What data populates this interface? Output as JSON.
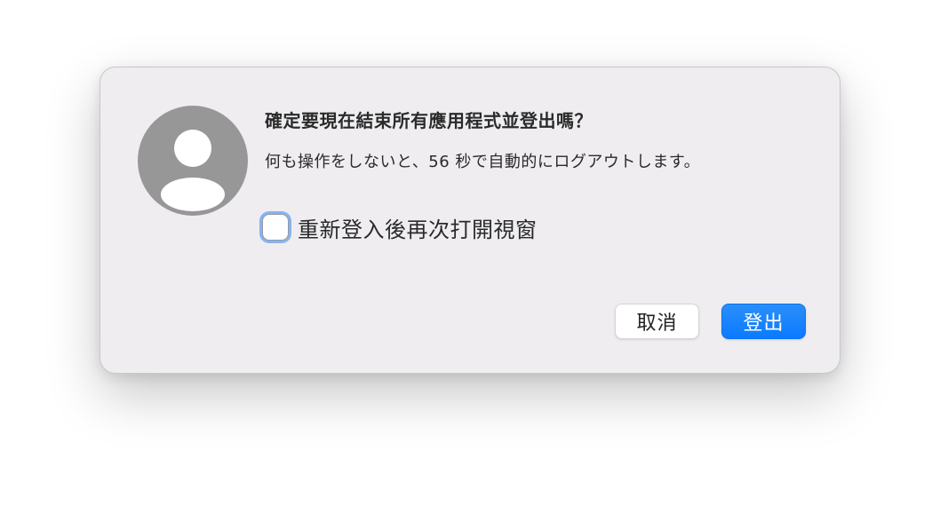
{
  "dialog": {
    "title": "確定要現在結束所有應用程式並登出嗎？",
    "message": "何も操作をしないと、56 秒で自動的にログアウトします。",
    "reopen_checkbox": {
      "label": "重新登入後再次打開視窗",
      "checked": false
    },
    "buttons": {
      "cancel_label": "取消",
      "logout_label": "登出"
    },
    "avatar_icon": "user-silhouette-icon",
    "colors": {
      "primary_button": "#0a7aff",
      "focus_ring": "#86b2f6",
      "avatar": "#979797",
      "dialog_background": "#efedf0"
    }
  }
}
